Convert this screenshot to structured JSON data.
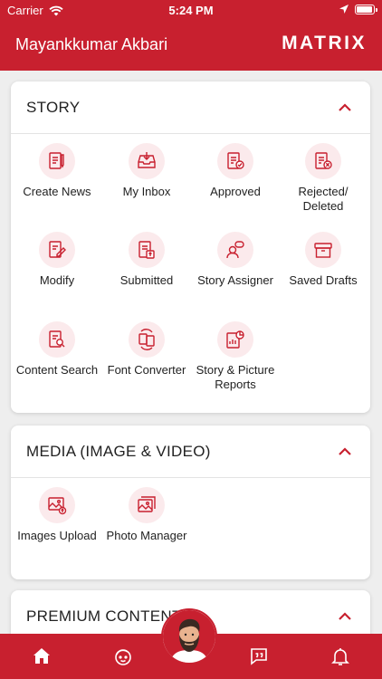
{
  "status_bar": {
    "carrier": "Carrier",
    "time": "5:24 PM",
    "battery_level": 0.95
  },
  "header": {
    "user_name": "Mayankkumar Akbari",
    "logo": "MATRIX"
  },
  "sections": [
    {
      "title": "STORY",
      "expanded": true,
      "items": [
        {
          "label": "Create News",
          "icon": "create-news-icon"
        },
        {
          "label": "My Inbox",
          "icon": "inbox-tray-icon"
        },
        {
          "label": "Approved",
          "icon": "approved-document-icon"
        },
        {
          "label": "Rejected/ Deleted",
          "icon": "rejected-document-icon"
        },
        {
          "label": "Modify",
          "icon": "edit-document-icon"
        },
        {
          "label": "Submitted",
          "icon": "submitted-document-icon"
        },
        {
          "label": "Story Assigner",
          "icon": "person-chat-icon"
        },
        {
          "label": "Saved Drafts",
          "icon": "archive-box-icon"
        },
        {
          "label": "Content Search",
          "icon": "document-search-icon"
        },
        {
          "label": "Font Converter",
          "icon": "font-convert-icon"
        },
        {
          "label": "Story & Picture Reports",
          "icon": "report-chart-icon"
        }
      ]
    },
    {
      "title": "MEDIA (IMAGE & VIDEO)",
      "expanded": true,
      "items": [
        {
          "label": "Images Upload",
          "icon": "image-upload-icon"
        },
        {
          "label": "Photo Manager",
          "icon": "photo-gallery-icon"
        }
      ]
    },
    {
      "title": "PREMIUM CONTENT",
      "expanded": true,
      "items": []
    }
  ],
  "tab_bar": {
    "tabs": [
      "home-icon",
      "face-icon",
      "profile-avatar",
      "feedback-chat-icon",
      "notification-bell-icon"
    ]
  },
  "colors": {
    "brand_red": "#c8202f",
    "icon_circle": "#fbeaec",
    "background": "#eeeeee"
  }
}
